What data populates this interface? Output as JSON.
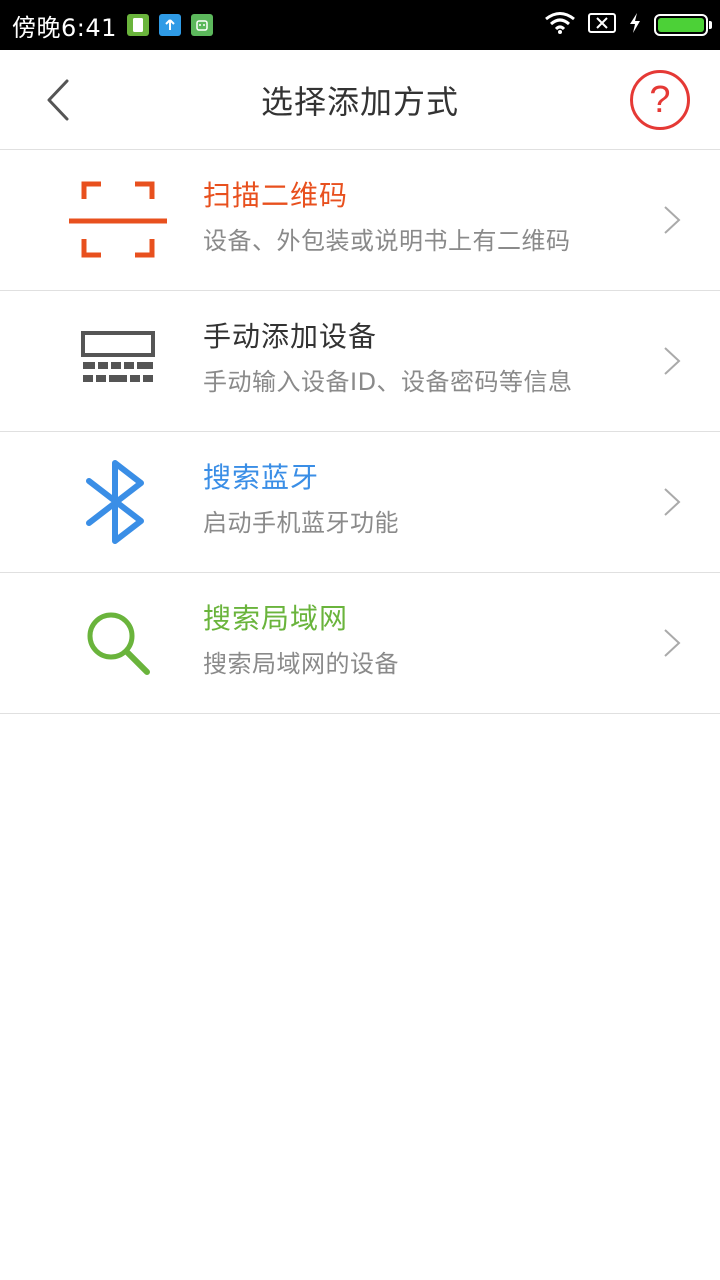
{
  "status_bar": {
    "time": "傍晚6:41",
    "battery_level": 1.0,
    "notif_icons": [
      "sim-card-icon",
      "upload-icon",
      "android-app-icon"
    ]
  },
  "header": {
    "title": "选择添加方式",
    "back_icon": "chevron-left-icon",
    "help_label": "?"
  },
  "colors": {
    "scan": "#e8501e",
    "manual": "#333333",
    "bluetooth": "#3a8ee6",
    "lan": "#6ab43c",
    "help": "#e53935"
  },
  "options": [
    {
      "title": "扫描二维码",
      "subtitle": "设备、外包装或说明书上有二维码",
      "icon": "qr-scan-icon"
    },
    {
      "title": "手动添加设备",
      "subtitle": "手动输入设备ID、设备密码等信息",
      "icon": "keyboard-icon"
    },
    {
      "title": "搜索蓝牙",
      "subtitle": "启动手机蓝牙功能",
      "icon": "bluetooth-icon"
    },
    {
      "title": "搜索局域网",
      "subtitle": "搜索局域网的设备",
      "icon": "search-icon"
    }
  ]
}
